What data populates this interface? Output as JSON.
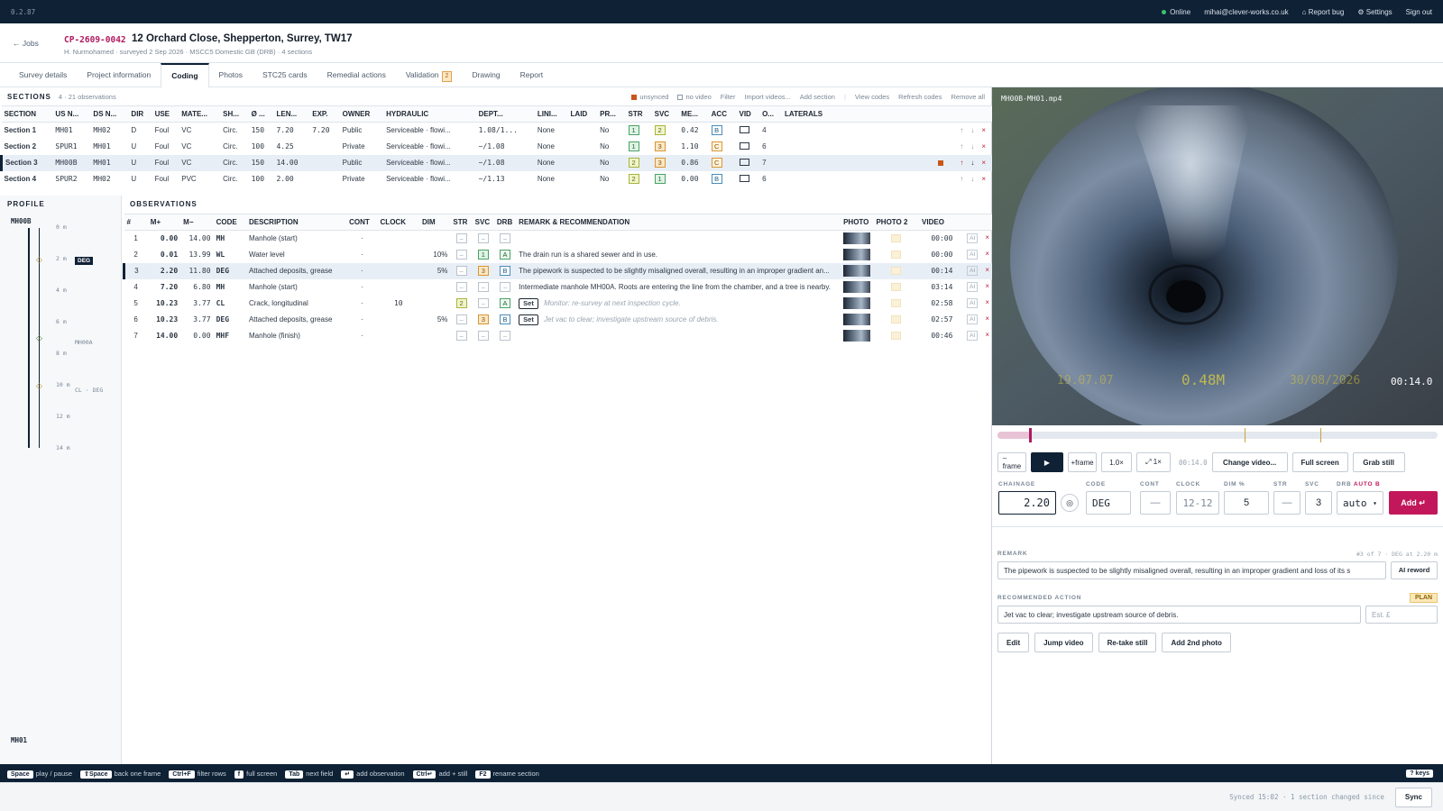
{
  "topbar": {
    "version": "0.2.87",
    "status": "Online",
    "email": "mihai@clever-works.co.uk",
    "report_bug": "Report bug",
    "settings": "Settings",
    "sign_out": "Sign out"
  },
  "job": {
    "back": "← Jobs",
    "id": "CP-2609-0042",
    "address": "12 Orchard Close, Shepperton, Surrey, TW17",
    "subtitle": "H. Nurmohamed · surveyed 2 Sep 2026 · MSCC5 Domestic GB (DRB) · 4 sections"
  },
  "tabs": [
    {
      "label": "Survey details"
    },
    {
      "label": "Project information"
    },
    {
      "label": "Coding",
      "active": true
    },
    {
      "label": "Photos"
    },
    {
      "label": "STC25 cards"
    },
    {
      "label": "Remedial actions"
    },
    {
      "label": "Validation",
      "badge": "2"
    },
    {
      "label": "Drawing"
    },
    {
      "label": "Report"
    }
  ],
  "sections_header": {
    "title": "SECTIONS",
    "count": "4 · 21 observations",
    "unsynced": "unsynced",
    "no_video": "no video",
    "filter": "Filter",
    "import": "Import videos...",
    "add": "Add section",
    "view_codes": "View codes",
    "refresh": "Refresh codes",
    "remove_all": "Remove all"
  },
  "section_columns": [
    "SECTION",
    "US N...",
    "DS N...",
    "DIR",
    "USE",
    "MATE...",
    "SH...",
    "Ø ...",
    "LEN...",
    "EXP.",
    "OWNER",
    "HYDRAULIC",
    "DEPT...",
    "LINI...",
    "LAID",
    "PR...",
    "STR",
    "SVC",
    "ME...",
    "ACC",
    "VID",
    "O...",
    "LATERALS"
  ],
  "sections": [
    {
      "name": "Section 1",
      "us": "MH01",
      "ds": "MH02",
      "dir": "D",
      "use": "Foul",
      "mat": "VC",
      "shape": "Circ.",
      "dia": "150",
      "len": "7.20",
      "exp": "7.20",
      "owner": "Public",
      "hyd": "Serviceable · flowi...",
      "depth": "1.08/1...",
      "lining": "None",
      "laid": "",
      "pr": "No",
      "str": "1",
      "svc": "2",
      "me": "0.42",
      "acc": "B",
      "obs": "4",
      "selected": false
    },
    {
      "name": "Section 2",
      "us": "SPUR1",
      "ds": "MH01",
      "dir": "U",
      "use": "Foul",
      "mat": "VC",
      "shape": "Circ.",
      "dia": "100",
      "len": "4.25",
      "exp": "",
      "owner": "Private",
      "hyd": "Serviceable · flowi...",
      "depth": "~/1.08",
      "lining": "None",
      "laid": "",
      "pr": "No",
      "str": "1",
      "svc": "3",
      "me": "1.10",
      "acc": "C",
      "obs": "6",
      "selected": false
    },
    {
      "name": "Section 3",
      "us": "MH00B",
      "ds": "MH01",
      "dir": "U",
      "use": "Foul",
      "mat": "VC",
      "shape": "Circ.",
      "dia": "150",
      "len": "14.00",
      "exp": "",
      "owner": "Public",
      "hyd": "Serviceable · flowi...",
      "depth": "~/1.08",
      "lining": "None",
      "laid": "",
      "pr": "No",
      "str": "2",
      "svc": "3",
      "me": "0.86",
      "acc": "C",
      "obs": "7",
      "selected": true
    },
    {
      "name": "Section 4",
      "us": "SPUR2",
      "ds": "MH02",
      "dir": "U",
      "use": "Foul",
      "mat": "PVC",
      "shape": "Circ.",
      "dia": "100",
      "len": "2.00",
      "exp": "",
      "owner": "Private",
      "hyd": "Serviceable · flowi...",
      "depth": "~/1.13",
      "lining": "None",
      "laid": "",
      "pr": "No",
      "str": "2",
      "svc": "1",
      "me": "0.00",
      "acc": "B",
      "obs": "6",
      "selected": false
    }
  ],
  "profile": {
    "title": "PROFILE",
    "top_node": "MH00B",
    "bottom_node": "MH01",
    "ticks": [
      "0 m",
      "2 m",
      "4 m",
      "6 m",
      "8 m",
      "10 m",
      "12 m",
      "14 m"
    ],
    "badge": "DEG",
    "mid_label": "MH00A",
    "label_10": "CL · DEG"
  },
  "observations_title": "OBSERVATIONS",
  "obs_columns": [
    "#",
    "M+",
    "M−",
    "CODE",
    "DESCRIPTION",
    "CONT",
    "CLOCK",
    "DIM",
    "STR",
    "SVC",
    "DRB",
    "REMARK & RECOMMENDATION",
    "PHOTO",
    "PHOTO 2",
    "VIDEO"
  ],
  "observations": [
    {
      "n": "1",
      "mp": "0.00",
      "mm": "14.00",
      "code": "MH",
      "desc": "Manhole (start)",
      "cont": "·",
      "clock": "",
      "dim": "",
      "str": "–",
      "svc": "–",
      "drb": "–",
      "remark": "",
      "rec": "",
      "set": false,
      "video": "00:00",
      "selected": false
    },
    {
      "n": "2",
      "mp": "0.01",
      "mm": "13.99",
      "code": "WL",
      "desc": "Water level",
      "cont": "·",
      "clock": "",
      "dim": "10%",
      "str": "–",
      "svc": "1",
      "drb": "A",
      "remark": "The drain run is a shared sewer and in use.",
      "rec": "",
      "set": false,
      "video": "00:00",
      "selected": false
    },
    {
      "n": "3",
      "mp": "2.20",
      "mm": "11.80",
      "code": "DEG",
      "desc": "Attached deposits, grease",
      "cont": "·",
      "clock": "",
      "dim": "5%",
      "str": "–",
      "svc": "3",
      "drb": "B",
      "remark": "The pipework is suspected to be slightly misaligned overall, resulting in an improper gradient an...",
      "rec": "",
      "set": false,
      "video": "00:14",
      "selected": true
    },
    {
      "n": "4",
      "mp": "7.20",
      "mm": "6.80",
      "code": "MH",
      "desc": "Manhole (start)",
      "cont": "·",
      "clock": "",
      "dim": "",
      "str": "–",
      "svc": "–",
      "drb": "–",
      "remark": "Intermediate manhole MH00A. Roots are entering the line from the chamber, and a tree is nearby.",
      "rec": "",
      "set": false,
      "video": "03:14",
      "selected": false
    },
    {
      "n": "5",
      "mp": "10.23",
      "mm": "3.77",
      "code": "CL",
      "desc": "Crack, longitudinal",
      "cont": "·",
      "clock": "10",
      "dim": "",
      "str": "2",
      "svc": "–",
      "drb": "A",
      "remark": "",
      "rec": "Monitor: re-survey at next inspection cycle.",
      "set": true,
      "video": "02:58",
      "selected": false
    },
    {
      "n": "6",
      "mp": "10.23",
      "mm": "3.77",
      "code": "DEG",
      "desc": "Attached deposits, grease",
      "cont": "·",
      "clock": "",
      "dim": "5%",
      "str": "–",
      "svc": "3",
      "drb": "B",
      "remark": "",
      "rec": "Jet vac to clear; investigate upstream source of debris.",
      "set": true,
      "video": "02:57",
      "selected": false
    },
    {
      "n": "7",
      "mp": "14.00",
      "mm": "0.00",
      "code": "MHF",
      "desc": "Manhole (finish)",
      "cont": "·",
      "clock": "",
      "dim": "",
      "str": "–",
      "svc": "–",
      "drb": "–",
      "remark": "",
      "rec": "",
      "set": false,
      "video": "00:46",
      "selected": false
    }
  ],
  "obs_set_label": "Set",
  "obs_ai_label": "AI",
  "video": {
    "filename": "MH00B-MH01.mp4",
    "overlay_left": "19.07.07",
    "overlay_distance": "0.48M",
    "overlay_right": "30/08/2026",
    "timecode": "00:14.0"
  },
  "controls": {
    "prev_frame": "–frame",
    "next_frame": "+frame",
    "speed": "1.0×",
    "zoom": "⤢ 1×",
    "time": "00:14.0",
    "change_video": "Change video...",
    "full_screen": "Full screen",
    "grab_still": "Grab still"
  },
  "entry": {
    "chainage_label": "CHAINAGE",
    "chainage": "2.20",
    "code_label": "CODE",
    "code": "DEG",
    "cont_label": "CONT",
    "cont": "—",
    "clock_label": "CLOCK",
    "clock": "12-12",
    "dim_label": "DIM %",
    "dim": "5",
    "str_label": "STR",
    "str": "—",
    "svc_label": "SVC",
    "svc": "3",
    "drb_label": "DRB",
    "drb_auto": "AUTO B",
    "drb": "auto",
    "add": "Add ↵"
  },
  "remark": {
    "label": "REMARK",
    "meta": "#3 of 7 · DEG at 2.20 m",
    "text": "The pipework is suspected to be slightly misaligned overall, resulting in an improper gradient and loss of its s",
    "ai_reword": "AI reword"
  },
  "recommended": {
    "label": "RECOMMENDED ACTION",
    "badge": "PLAN",
    "text": "Jet vac to clear; investigate upstream source of debris.",
    "est_placeholder": "Est. £"
  },
  "actions": {
    "edit": "Edit",
    "jump": "Jump video",
    "retake": "Re-take still",
    "add2": "Add 2nd photo"
  },
  "hotkeys": [
    {
      "key": "Space",
      "desc": "play / pause"
    },
    {
      "key": "⇧Space",
      "desc": "back one frame"
    },
    {
      "key": "Ctrl+F",
      "desc": "filter rows"
    },
    {
      "key": "f",
      "desc": "full screen"
    },
    {
      "key": "Tab",
      "desc": "next field"
    },
    {
      "key": "↵",
      "desc": "add observation"
    },
    {
      "key": "Ctrl↵",
      "desc": "add + still"
    },
    {
      "key": "F2",
      "desc": "rename section"
    }
  ],
  "keys_button": "? keys",
  "status": {
    "synced": "Synced 15:02 · 1 section changed since",
    "sync": "Sync"
  },
  "colors": {
    "navy": "#0f2135",
    "accent": "#c2185b",
    "id_color": "#b0195e"
  }
}
